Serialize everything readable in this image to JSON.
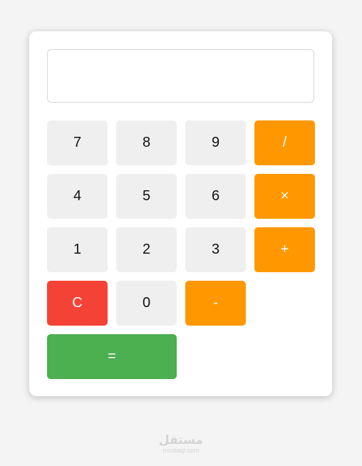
{
  "calculator": {
    "display": {
      "value": "",
      "placeholder": ""
    },
    "keys": [
      {
        "label": "7",
        "kind": "number",
        "name": "key-7"
      },
      {
        "label": "8",
        "kind": "number",
        "name": "key-8"
      },
      {
        "label": "9",
        "kind": "number",
        "name": "key-9"
      },
      {
        "label": "/",
        "kind": "operator",
        "name": "divide-button"
      },
      {
        "label": "4",
        "kind": "number",
        "name": "key-4"
      },
      {
        "label": "5",
        "kind": "number",
        "name": "key-5"
      },
      {
        "label": "6",
        "kind": "number",
        "name": "key-6"
      },
      {
        "label": "×",
        "kind": "operator",
        "name": "multiply-button"
      },
      {
        "label": "1",
        "kind": "number",
        "name": "key-1"
      },
      {
        "label": "2",
        "kind": "number",
        "name": "key-2"
      },
      {
        "label": "3",
        "kind": "number",
        "name": "key-3"
      },
      {
        "label": "+",
        "kind": "operator",
        "name": "add-button"
      },
      {
        "label": "C",
        "kind": "clear",
        "name": "clear-button"
      },
      {
        "label": "0",
        "kind": "number",
        "name": "key-0"
      },
      {
        "label": "-",
        "kind": "operator",
        "name": "subtract-button"
      },
      {
        "label": "=",
        "kind": "equals",
        "name": "equals-button"
      }
    ]
  },
  "colors": {
    "operator": "#ff9800",
    "clear": "#f44336",
    "equals": "#4caf50",
    "number": "#efefef",
    "background": "#f4f4f4"
  },
  "watermark": {
    "brand": "مستقل",
    "domain": "mostaql.com"
  }
}
